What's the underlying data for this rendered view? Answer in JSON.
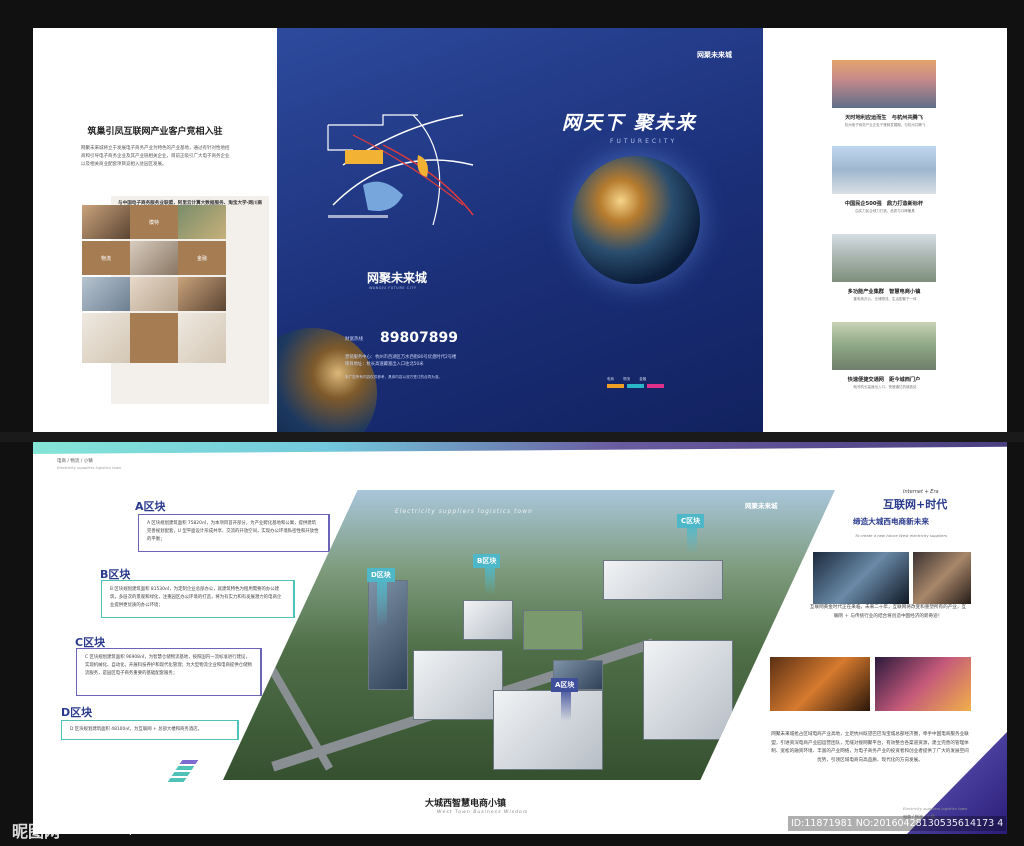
{
  "top_left": {
    "title": "筑巢引凤互联网产业客户竞相入驻",
    "body": "网聚未来城将立于发展电子商务产业为特色的产业基地，通过有针对性地招商和引导电子商务企业及其产业链相关企业，目前正吸引广大电子商务企业以及相关商业配套项目竞相入驻园区发展。",
    "panel_text": "与中国电子商务服务业联盟，阿里云计算大数据服务、淘宝大学·网川商学院等达成初步合作意向",
    "tiles": [
      "模特",
      "物流",
      "金融"
    ]
  },
  "top_mid": {
    "logo": "网聚未来城",
    "logo_sub": "WANGJU FUTURE CITY",
    "brand": "网聚未来城",
    "slogan": "网天下 聚未来",
    "slogan_en": "FUTURECITY",
    "hotline_label": "财富热线",
    "hotline": "89807899",
    "address": [
      "营销服务中心：杭州市西湖区万水西街80号优盘时代2号楼",
      "项目地址：杭长高速藏富出入口往北50米"
    ],
    "disclaimer": "本广告所有内容仅供参考，具体内容以双方签订的合同为准。",
    "swatch_labels": "电商 物流 金融",
    "swatch_colors": [
      "#f0a020",
      "#29b6c6",
      "#e0308a"
    ]
  },
  "top_right": {
    "items": [
      {
        "caption": "天时地利应运而生　与杭州共腾飞",
        "sub": "杭州电子商务产业正处于蓬勃发展期，与杭州共腾飞"
      },
      {
        "caption": "中国民企500强　鼎力打造新标杆",
        "sub": "由实力民企倾力打造，品质与口碑兼具"
      },
      {
        "caption": "多功能产业集群　智慧电商小镇",
        "sub": "集电商办公、仓储物流、生活配套于一体"
      },
      {
        "caption": "快速便捷交通网　距今城西门户",
        "sub": "毗邻杭长高速出入口，快速通达杭城各处"
      }
    ]
  },
  "bottom": {
    "tag": "电商 / 物流 / 小镇",
    "tag_en": "Electricity suppliers logistics town",
    "zones": [
      {
        "heading": "A区块",
        "text": "A 区块规划建筑面积 75820㎡，为本项目首开部分，为产业孵化基地和公寓，提供建筑完善规划配套，U 型平面设计形成共享、交流的开放空间，实现办公环境私密性和开放性的平衡；"
      },
      {
        "heading": "B区块",
        "text": "B 区块规划建筑面积 81530㎡，为定制企业总部办公，就建筑特色为租用需要的办公建筑，多层次的景观和绿化，注重园区办公环境的打造，将为有实力和有发展潜力的电商企业提供更优质的办公环境；"
      },
      {
        "heading": "C区块",
        "text": "C 区块规划建筑面积 96908㎡，为智慧仓储物流基地，按照国内一流标准进行建设，实现机械化、自动化，开展科技养护和现代化管理；为大型物流企业和电商提供仓储物流服务，是园区电子商务重要的基础配套服务；"
      },
      {
        "heading": "D区块",
        "text": "D 区块规划建筑面积 48100㎡，为互联网 + 总部大楼和商务酒店。"
      }
    ],
    "pins": [
      "C区块",
      "B区块",
      "D区块",
      "A区块"
    ],
    "aerial_logo": "网聚未来城",
    "aerial_en": "Electricity suppliers logistics town",
    "caption": "大城西智慧电商小镇",
    "caption_en": "West Town Business Wisdom",
    "right_en": "Internet + Era",
    "right_title": "互联网+时代",
    "right_sub": "缔造大城西电商新未来",
    "right_sub_en": "To create a new future West electricity suppliers",
    "para1": "互联网黄金时代正在来临，未来二十年，互联网将改变和重塑所有的产业，互联网 ＋ 与传统行业的结合将创造中国经济的新奇迹！",
    "para2": "网聚未来城抢占区域电商产业高地，立足杭州既望巴巴淘宝城总部经济圈，牵手中国电商服务业联盟，引进资深电商产业园运营团队，无缝对接网聚平台，有效整合各渠道资源，建立完善的管理体制、宽松的融资环境、丰富的产业网络，为电子商务产业的投资者和创业者提供了广大的发展空间优势，引领区域电商向高品质、现代化的方向发展。",
    "foot": "电商 / 物流 / 小镇",
    "foot_en": "Electricity suppliers logistics town"
  },
  "watermark": {
    "logo": "昵图网",
    "url": "www.nipic.com",
    "id": "ID:11871981 NO:20160428130535614173 4"
  }
}
